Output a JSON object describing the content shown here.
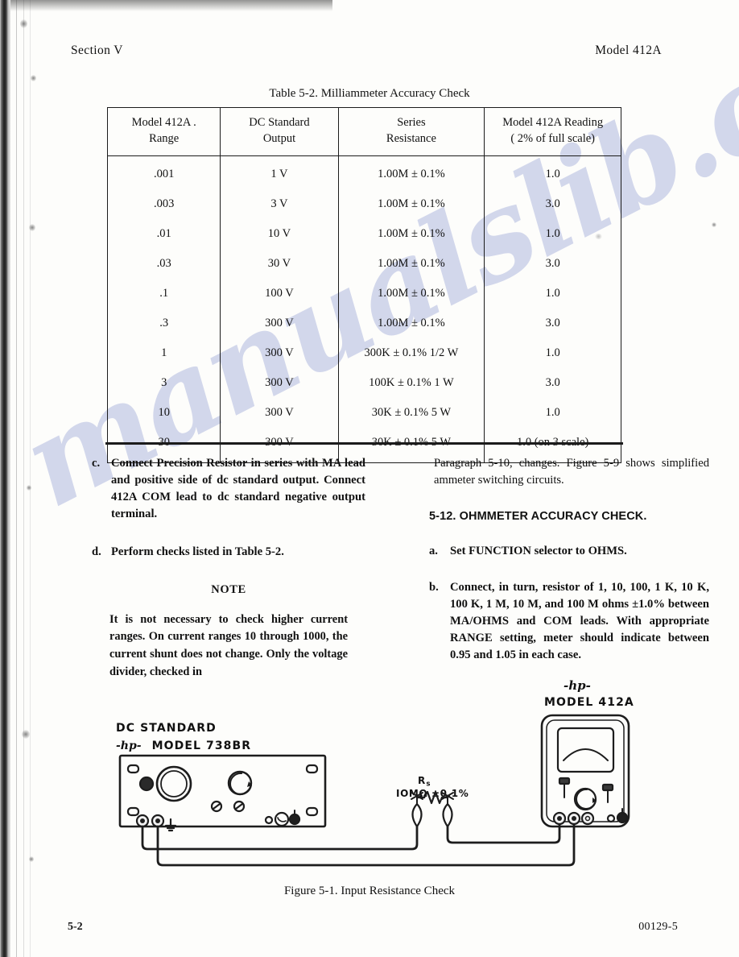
{
  "page": {
    "running_head_left": "Section V",
    "running_head_right": "Model 412A",
    "footer_left": "5-2",
    "footer_right": "00129-5",
    "watermark": "manualslib.com"
  },
  "table": {
    "caption": "Table 5-2.  Milliammeter Accuracy Check",
    "headers": [
      {
        "line1": "Model 412A  .",
        "line2": "Range"
      },
      {
        "line1": "DC Standard",
        "line2": "Output"
      },
      {
        "line1": "Series",
        "line2": "Resistance"
      },
      {
        "line1": "Model 412A Reading",
        "line2": "(  2% of full scale)"
      }
    ],
    "rows": [
      {
        "range": ".001",
        "output": "1 V",
        "resistance": "1.00M ± 0.1%",
        "reading": "1.0"
      },
      {
        "range": ".003",
        "output": "3 V",
        "resistance": "1.00M ± 0.1%",
        "reading": "3.0"
      },
      {
        "range": ".01",
        "output": "10 V",
        "resistance": "1.00M ± 0.1%",
        "reading": "1.0"
      },
      {
        "range": ".03",
        "output": "30 V",
        "resistance": "1.00M ± 0.1%",
        "reading": "3.0"
      },
      {
        "range": ".1",
        "output": "100 V",
        "resistance": "1.00M ± 0.1%",
        "reading": "1.0"
      },
      {
        "range": ".3",
        "output": "300 V",
        "resistance": "1.00M ± 0.1%",
        "reading": "3.0"
      },
      {
        "range": "1",
        "output": "300 V",
        "resistance": "300K ± 0.1% 1/2 W",
        "reading": "1.0"
      },
      {
        "range": "3",
        "output": "300 V",
        "resistance": "100K ± 0.1% 1 W",
        "reading": "3.0"
      },
      {
        "range": "10",
        "output": "300 V",
        "resistance": "30K ± 0.1% 5 W",
        "reading": "1.0"
      },
      {
        "range": "30",
        "output": "300 V",
        "resistance": "30K ± 0.1% 5 W",
        "reading": "1.0 (on 3 scale)"
      }
    ]
  },
  "left_column": {
    "item_c_mark": "c.",
    "item_c_text": "Connect Precision Resistor in series with MA lead and positive side of dc standard output. Connect 412A COM lead to dc standard negative output terminal.",
    "item_d_mark": "d.",
    "item_d_text": "Perform checks listed in Table 5-2.",
    "note_heading": "NOTE",
    "note_text": "It is not necessary to check higher current ranges. On current ranges 10 through 1000, the current shunt does not change. Only the voltage divider, checked in"
  },
  "right_column": {
    "continued_text": "Paragraph 5-10, changes. Figure 5-9 shows simplified ammeter switching circuits.",
    "section_number_title": "5-12. OHMMETER ACCURACY CHECK.",
    "item_a_mark": "a.",
    "item_a_text": "Set FUNCTION selector to OHMS.",
    "item_b_mark": "b.",
    "item_b_text": "Connect, in turn, resistor of 1, 10, 100, 1 K, 10 K, 100 K, 1 M, 10 M, and 100 M ohms ±1.0% between MA/OHMS and COM leads. With appropriate RANGE setting, meter should indicate between 0.95 and 1.05 in each case."
  },
  "figure": {
    "caption": "Figure 5-1.  Input Resistance Check",
    "dc_standard_line1": "DC STANDARD",
    "dc_standard_hp": "-hp-",
    "dc_standard_line2": "MODEL 738BR",
    "meter_hp": "-hp-",
    "meter_model": "MODEL 412A",
    "resistor_symbol": "R",
    "resistor_subscript": "s",
    "resistor_value": "IOMΩ ±0.1%"
  }
}
